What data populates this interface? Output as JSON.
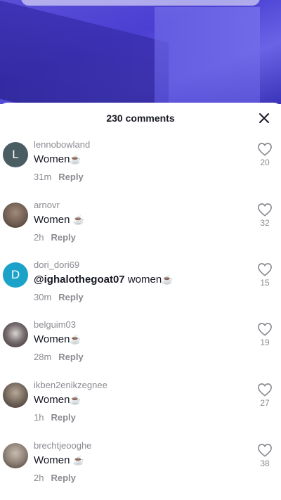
{
  "header": {
    "comment_count": "230 comments"
  },
  "comments": [
    {
      "username": "lennobowland",
      "avatar_letter": "L",
      "avatar_color": "#4a5d63",
      "text": "Women",
      "emoji": "☕",
      "time": "31m",
      "reply": "Reply",
      "likes": "20"
    },
    {
      "username": "arnovr",
      "avatar_letter": "",
      "avatar_color": "#7a6a5e",
      "text": "Women",
      "emoji": "☕",
      "time": "2h",
      "reply": "Reply",
      "likes": "32"
    },
    {
      "username": "dori_dori69",
      "avatar_letter": "D",
      "avatar_color": "#1aa2c9",
      "mention": "@ighalothegoat07",
      "text": "women",
      "emoji": "☕",
      "time": "30m",
      "reply": "Reply",
      "likes": "15"
    },
    {
      "username": "belguim03",
      "avatar_letter": "",
      "avatar_color": "#5b5556",
      "text": "Women",
      "emoji": "☕",
      "time": "28m",
      "reply": "Reply",
      "likes": "19"
    },
    {
      "username": "ikben2enikzegnee",
      "avatar_letter": "",
      "avatar_color": "#6e6258",
      "text": "Women",
      "emoji": "☕",
      "time": "1h",
      "reply": "Reply",
      "likes": "27"
    },
    {
      "username": "brechtjeooghe",
      "avatar_letter": "",
      "avatar_color": "#8a7c70",
      "text": "Women",
      "emoji": "☕",
      "time": "2h",
      "reply": "Reply",
      "likes": "38"
    }
  ]
}
